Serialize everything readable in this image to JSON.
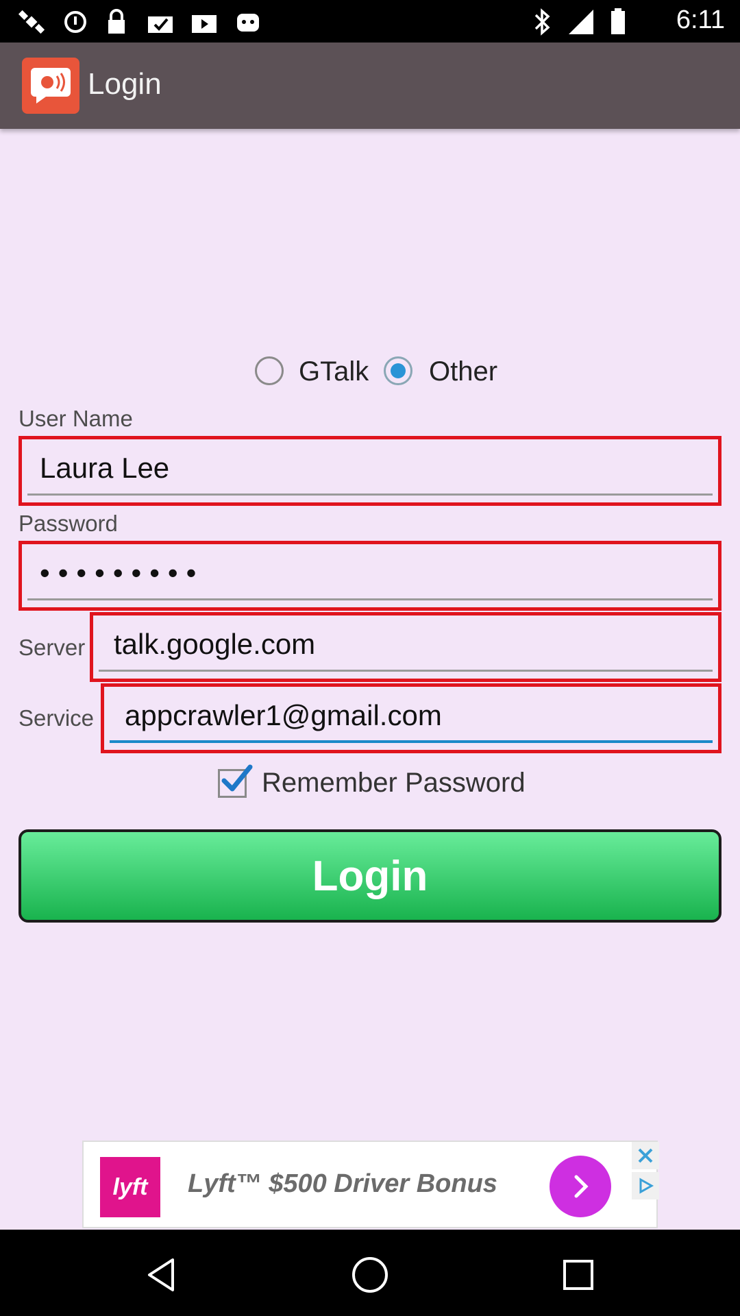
{
  "status_bar": {
    "time": "6:11",
    "icons": [
      "satellite-icon",
      "data-saver-icon",
      "lock-icon",
      "clipboard-check-icon",
      "play-store-icon",
      "android-icon",
      "bluetooth-icon",
      "signal-icon",
      "battery-icon"
    ]
  },
  "app_bar": {
    "title": "Login",
    "logo_icon": "chat-bubble-speaker-icon"
  },
  "account_type": {
    "options": [
      {
        "label": "GTalk",
        "checked": false
      },
      {
        "label": "Other",
        "checked": true
      }
    ]
  },
  "form": {
    "username_label": "User Name",
    "username_value": "Laura Lee",
    "password_label": "Password",
    "password_value": "•••••••••",
    "server_label": "Server",
    "server_value": "talk.google.com",
    "service_label": "Service",
    "service_value": "appcrawler1@gmail.com",
    "remember_label": "Remember Password",
    "remember_checked": true
  },
  "login_button": {
    "label": "Login"
  },
  "ad": {
    "brand": "lyft",
    "text": "Lyft™ $500 Driver Bonus"
  },
  "colors": {
    "background": "#f3e5f8",
    "app_bar": "#5c5156",
    "field_border": "#e0141e",
    "radio_accent": "#2a94d6",
    "button_green": "#19b34e"
  }
}
